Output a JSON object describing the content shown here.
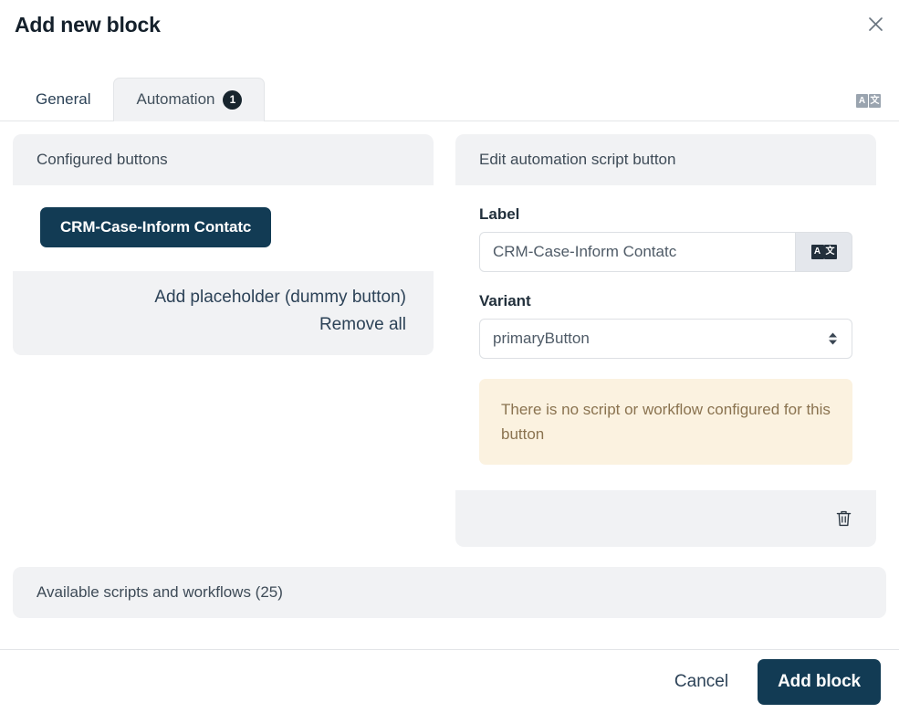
{
  "dialog": {
    "title": "Add new block",
    "close_icon": "close-icon"
  },
  "tabs": [
    {
      "label": "General",
      "active": false,
      "badge": null
    },
    {
      "label": "Automation",
      "active": true,
      "badge": "1"
    }
  ],
  "header_translate": {
    "icon": "translate-icon",
    "glyph_latin": "A",
    "glyph_cjk": "文"
  },
  "configured_panel": {
    "header": "Configured buttons",
    "buttons": [
      {
        "label": "CRM-Case-Inform Contatc",
        "variant": "primaryButton"
      }
    ],
    "actions": [
      {
        "label": "Add placeholder (dummy button)",
        "name": "add-placeholder-link"
      },
      {
        "label": "Remove all",
        "name": "remove-all-link"
      }
    ]
  },
  "edit_panel": {
    "header": "Edit automation script button",
    "label_field": {
      "label": "Label",
      "value": "CRM-Case-Inform Contatc",
      "placeholder": "CRM-Case-Inform Contatc",
      "translate_icon": "translate-icon",
      "glyph_latin": "A",
      "glyph_cjk": "文"
    },
    "variant_field": {
      "label": "Variant",
      "value": "primaryButton",
      "options": [
        "primaryButton"
      ]
    },
    "alert": "There is no script or workflow configured for this button",
    "delete_icon": "trash-icon"
  },
  "available_section": {
    "header": "Available scripts and workflows (25)"
  },
  "action_bar": {
    "cancel_label": "Cancel",
    "submit_label": "Add block"
  },
  "colors": {
    "primary": "#123b54",
    "panel_header_bg": "#f1f2f4",
    "alert_bg": "#fbf2e0",
    "alert_text": "#8a7350",
    "badge_bg": "#18252e"
  }
}
